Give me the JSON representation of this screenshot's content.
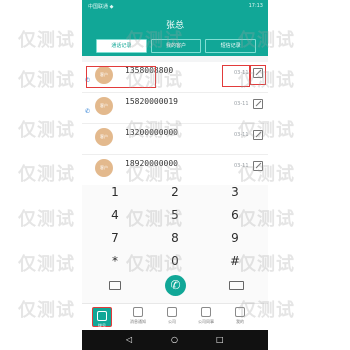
{
  "status": {
    "left": "中国联通 ◆",
    "right": "17:13"
  },
  "title": "张总",
  "tabs": [
    "通话记录",
    "我的客户",
    "短信记录"
  ],
  "rows": [
    {
      "number": "1358008800",
      "date": "03-11",
      "avatar": "客户"
    },
    {
      "number": "15820000019",
      "date": "03-11",
      "avatar": "客户"
    },
    {
      "number": "13200000000",
      "date": "03-11",
      "avatar": "客户"
    },
    {
      "number": "18920000000",
      "date": "03-11",
      "avatar": "客户"
    }
  ],
  "keys": [
    [
      "1",
      "2",
      "3"
    ],
    [
      "4",
      "5",
      "6"
    ],
    [
      "7",
      "8",
      "9"
    ],
    [
      "*",
      "0",
      "#"
    ]
  ],
  "nav": [
    "拨号",
    "消息通知",
    "公司",
    "公司同事",
    "我的"
  ],
  "system_nav": [
    "◁",
    "○",
    "□"
  ],
  "watermark": "仅测试",
  "icons": [
    "phone-icon",
    "edit-icon",
    "backspace-icon",
    "grid-icon",
    "dial-icon"
  ],
  "colors": {
    "accent": "#11a797",
    "highlight": "#e23b3b"
  }
}
